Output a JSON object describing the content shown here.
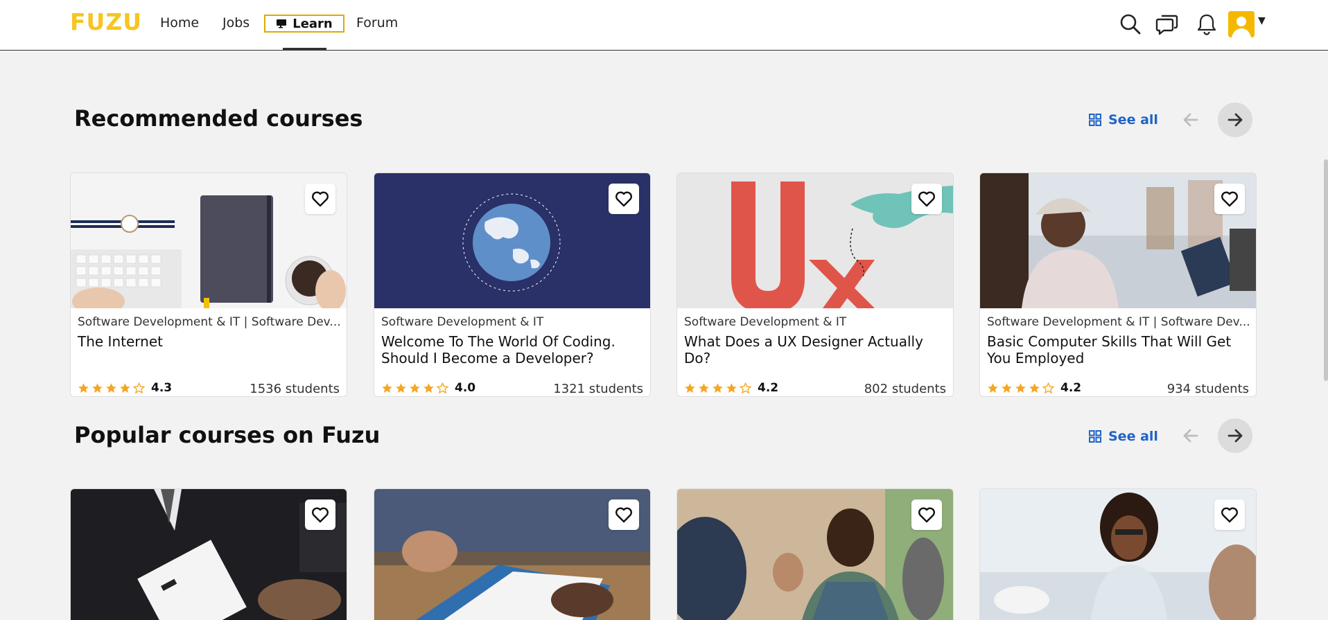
{
  "nav": {
    "logo": "FUZU",
    "links": {
      "home": "Home",
      "jobs": "Jobs",
      "learn": "Learn",
      "forum": "Forum"
    },
    "icons": [
      "search-icon",
      "chat-icon",
      "bell-icon",
      "avatar"
    ],
    "accent": "#f7c51e"
  },
  "recommended": {
    "title": "Recommended courses",
    "see_all": "See all",
    "courses": [
      {
        "category": "Software Development & IT | Software Dev...",
        "title": "The Internet",
        "rating": "4.3",
        "students": "1536 students"
      },
      {
        "category": "Software Development & IT",
        "title": "Welcome To The World Of Coding. Should I Become a Developer?",
        "rating": "4.0",
        "students": "1321 students"
      },
      {
        "category": "Software Development & IT",
        "title": "What Does a UX Designer Actually Do?",
        "rating": "4.2",
        "students": "802 students"
      },
      {
        "category": "Software Development & IT | Software Dev...",
        "title": "Basic Computer Skills That Will Get You Employed",
        "rating": "4.2",
        "students": "934 students"
      }
    ]
  },
  "popular": {
    "title": "Popular courses on Fuzu",
    "see_all": "See all"
  },
  "colors": {
    "link": "#1f63c6",
    "star": "#f5a623"
  }
}
